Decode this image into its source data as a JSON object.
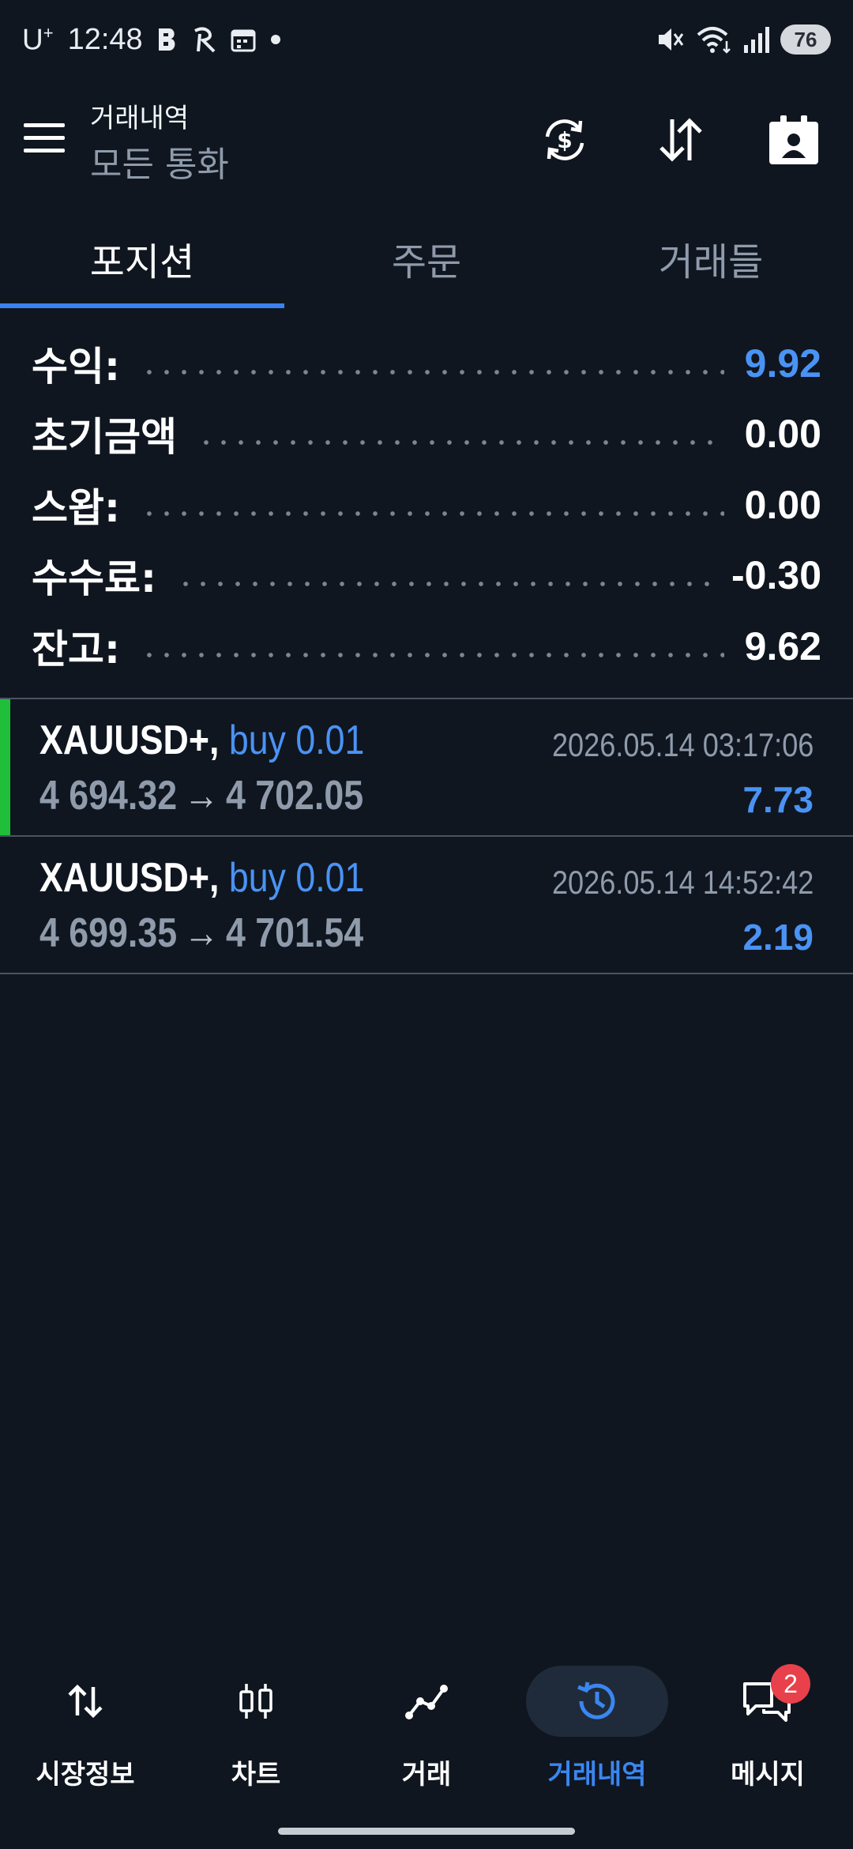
{
  "status_bar": {
    "carrier": "U",
    "carrier_sup": "+",
    "time": "12:48",
    "battery": "76"
  },
  "header": {
    "title": "거래내역",
    "subtitle": "모든 통화"
  },
  "tabs": [
    {
      "label": "포지션",
      "active": true
    },
    {
      "label": "주문",
      "active": false
    },
    {
      "label": "거래들",
      "active": false
    }
  ],
  "summary": [
    {
      "label": "수익:",
      "value": "9.92"
    },
    {
      "label": "초기금액",
      "value": "0.00"
    },
    {
      "label": "스왑:",
      "value": "0.00"
    },
    {
      "label": "수수료:",
      "value": "-0.30"
    },
    {
      "label": "잔고:",
      "value": "9.62"
    }
  ],
  "deals": [
    {
      "symbol": "XAUUSD+,",
      "type": "buy 0.01",
      "time": "2026.05.14 03:17:06",
      "open_price": "4 694.32",
      "arrow": "→",
      "close_price": "4 702.05",
      "profit": "7.73"
    },
    {
      "symbol": "XAUUSD+,",
      "type": "buy 0.01",
      "time": "2026.05.14 14:52:42",
      "open_price": "4 699.35",
      "arrow": "→",
      "close_price": "4 701.54",
      "profit": "2.19"
    }
  ],
  "bottom_nav": [
    {
      "label": "시장정보",
      "icon": "quotes-arrows-icon"
    },
    {
      "label": "차트",
      "icon": "candlestick-icon"
    },
    {
      "label": "거래",
      "icon": "trade-line-icon"
    },
    {
      "label": "거래내역",
      "icon": "history-icon",
      "active": true
    },
    {
      "label": "메시지",
      "icon": "messages-icon",
      "badge": "2"
    }
  ],
  "colors": {
    "background": "#0f1620",
    "accent_blue": "#4a93f5",
    "highlight_green": "#1fbf3a",
    "badge_red": "#e8414b"
  }
}
